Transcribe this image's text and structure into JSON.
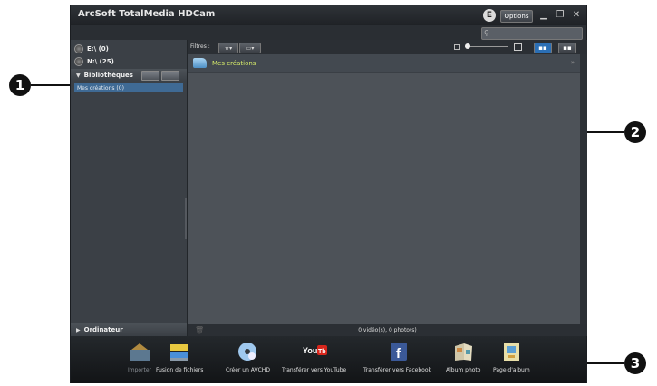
{
  "callouts": [
    "1",
    "2",
    "3"
  ],
  "titlebar": {
    "title": "ArcSoft TotalMedia HDCam",
    "e_label": "E",
    "options_label": "Options"
  },
  "sidebar": {
    "drives": [
      {
        "label": "E:\\ (0)"
      },
      {
        "label": "N:\\ (25)"
      }
    ],
    "libraries_label": "Bibliothèques",
    "library_item": "Mes créations (0)",
    "computer_label": "Ordinateur"
  },
  "filterbar": {
    "filter_label": "Filtres :",
    "star_button": "★▾",
    "media_button": "▭▾"
  },
  "content": {
    "folder_title": "Mes créations"
  },
  "status": {
    "text": "0 vidéo(s), 0 photo(s)"
  },
  "toolbar": {
    "items": [
      {
        "label": "Importer",
        "icon": "import-icon",
        "enabled": false
      },
      {
        "label": "Fusion de fichiers",
        "icon": "merge-files-icon",
        "enabled": true
      },
      {
        "label": "Créer un AVCHD",
        "icon": "disc-icon",
        "enabled": true
      },
      {
        "label": "Transférer vers YouTube",
        "icon": "youtube-icon",
        "enabled": true
      },
      {
        "label": "Transférer vers Facebook",
        "icon": "facebook-icon",
        "enabled": true
      },
      {
        "label": "Album photo",
        "icon": "photo-album-icon",
        "enabled": true
      },
      {
        "label": "Page d'album",
        "icon": "album-page-icon",
        "enabled": true
      }
    ]
  },
  "colors": {
    "selection": "#3f6a94",
    "folder_title": "#d7ec6a",
    "view_active": "#2b6fb5"
  }
}
